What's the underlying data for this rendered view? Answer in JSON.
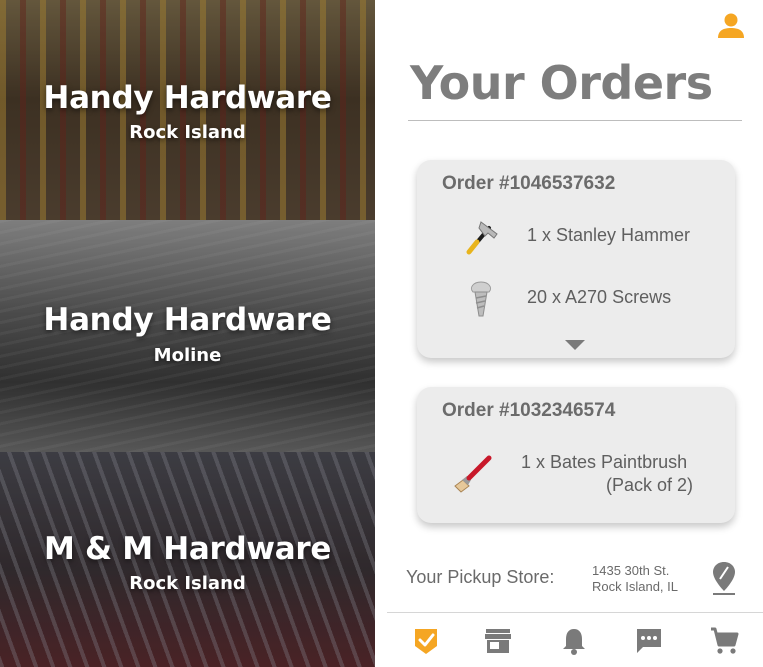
{
  "stores": [
    {
      "name": "Handy Hardware",
      "city": "Rock Island"
    },
    {
      "name": "Handy Hardware",
      "city": "Moline"
    },
    {
      "name": "M & M Hardware",
      "city": "Rock Island"
    }
  ],
  "orders_panel": {
    "title": "Your Orders",
    "orders": [
      {
        "order_number": "Order #1046537632",
        "items": [
          {
            "text": "1 x Stanley Hammer",
            "icon": "hammer-icon"
          },
          {
            "text": "20 x A270 Screws",
            "icon": "screw-icon"
          }
        ],
        "expand_icon": "chevron-down-icon"
      },
      {
        "order_number": "Order #1032346574",
        "items": [
          {
            "line1": "1 x Bates Paintbrush",
            "line2": "(Pack of 2)",
            "icon": "paintbrush-icon"
          }
        ]
      }
    ],
    "pickup": {
      "label": "Your Pickup Store:",
      "address_line1": "1435 30th St.",
      "address_line2": "Rock Island, IL",
      "icon": "location-pin-icon"
    }
  },
  "tabbar": [
    {
      "icon": "orders-check-icon",
      "active": true
    },
    {
      "icon": "store-icon",
      "active": false
    },
    {
      "icon": "bell-icon",
      "active": false
    },
    {
      "icon": "chat-icon",
      "active": false
    },
    {
      "icon": "cart-icon",
      "active": false
    }
  ],
  "colors": {
    "accent": "#F5A623",
    "icon_gray": "#7a7a7a",
    "title_gray": "#7d7d7d",
    "card_bg": "#ececec"
  }
}
